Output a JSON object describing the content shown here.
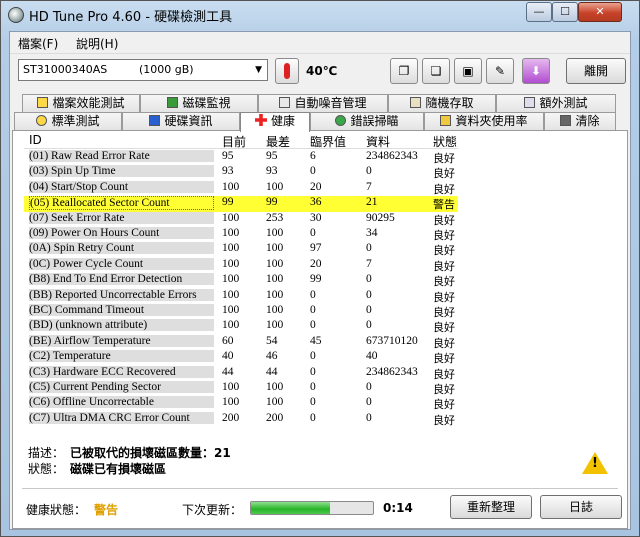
{
  "window": {
    "title": "HD Tune Pro 4.60 - 硬碟檢測工具"
  },
  "menu": {
    "items": [
      "檔案(F)",
      "說明(H)"
    ]
  },
  "toolbar": {
    "drive_name": "ST31000340AS",
    "drive_capacity": "(1000 gB)",
    "temperature": "40℃",
    "exit_label": "離開"
  },
  "tabs_row1": [
    "檔案效能測試",
    "磁碟監視",
    "自動噪音管理",
    "隨機存取",
    "額外測試"
  ],
  "tabs_row2": [
    "標準測試",
    "硬碟資訊",
    "健康",
    "錯誤掃瞄",
    "資料夾使用率",
    "清除"
  ],
  "table": {
    "headers": [
      "ID",
      "目前",
      "最差",
      "臨界值",
      "資料",
      "狀態"
    ],
    "rows": [
      [
        "(01) Raw Read Error Rate",
        "95",
        "95",
        "6",
        "234862343",
        "良好"
      ],
      [
        "(03) Spin Up Time",
        "93",
        "93",
        "0",
        "0",
        "良好"
      ],
      [
        "(04) Start/Stop Count",
        "100",
        "100",
        "20",
        "7",
        "良好"
      ],
      [
        "(05) Reallocated Sector Count",
        "99",
        "99",
        "36",
        "21",
        "警告"
      ],
      [
        "(07) Seek Error Rate",
        "100",
        "253",
        "30",
        "90295",
        "良好"
      ],
      [
        "(09) Power On Hours Count",
        "100",
        "100",
        "0",
        "34",
        "良好"
      ],
      [
        "(0A) Spin Retry Count",
        "100",
        "100",
        "97",
        "0",
        "良好"
      ],
      [
        "(0C) Power Cycle Count",
        "100",
        "100",
        "20",
        "7",
        "良好"
      ],
      [
        "(B8) End To End Error Detection",
        "100",
        "100",
        "99",
        "0",
        "良好"
      ],
      [
        "(BB) Reported Uncorrectable Errors",
        "100",
        "100",
        "0",
        "0",
        "良好"
      ],
      [
        "(BC) Command Timeout",
        "100",
        "100",
        "0",
        "0",
        "良好"
      ],
      [
        "(BD) (unknown attribute)",
        "100",
        "100",
        "0",
        "0",
        "良好"
      ],
      [
        "(BE) Airflow Temperature",
        "60",
        "54",
        "45",
        "673710120",
        "良好"
      ],
      [
        "(C2) Temperature",
        "40",
        "46",
        "0",
        "40",
        "良好"
      ],
      [
        "(C3) Hardware ECC Recovered",
        "44",
        "44",
        "0",
        "234862343",
        "良好"
      ],
      [
        "(C5) Current Pending Sector",
        "100",
        "100",
        "0",
        "0",
        "良好"
      ],
      [
        "(C6) Offline Uncorrectable",
        "100",
        "100",
        "0",
        "0",
        "良好"
      ],
      [
        "(C7) Ultra DMA CRC Error Count",
        "200",
        "200",
        "0",
        "0",
        "良好"
      ]
    ]
  },
  "details": {
    "desc_label": "描述：",
    "desc_value": "已被取代的損壞磁區數量：21",
    "status_label": "狀態：",
    "status_value": "磁碟已有損壞磁區"
  },
  "status_bar": {
    "health_label": "健康狀態：",
    "health_value": "警告",
    "next_update_label": "下次更新：",
    "progress_fraction": 0.65,
    "timer": "0:14",
    "refresh_label": "重新整理",
    "log_label": "日誌"
  },
  "colors": {
    "warn_row": "#ffff33",
    "health_warn": "#e0a000",
    "progress": "#27b427"
  }
}
